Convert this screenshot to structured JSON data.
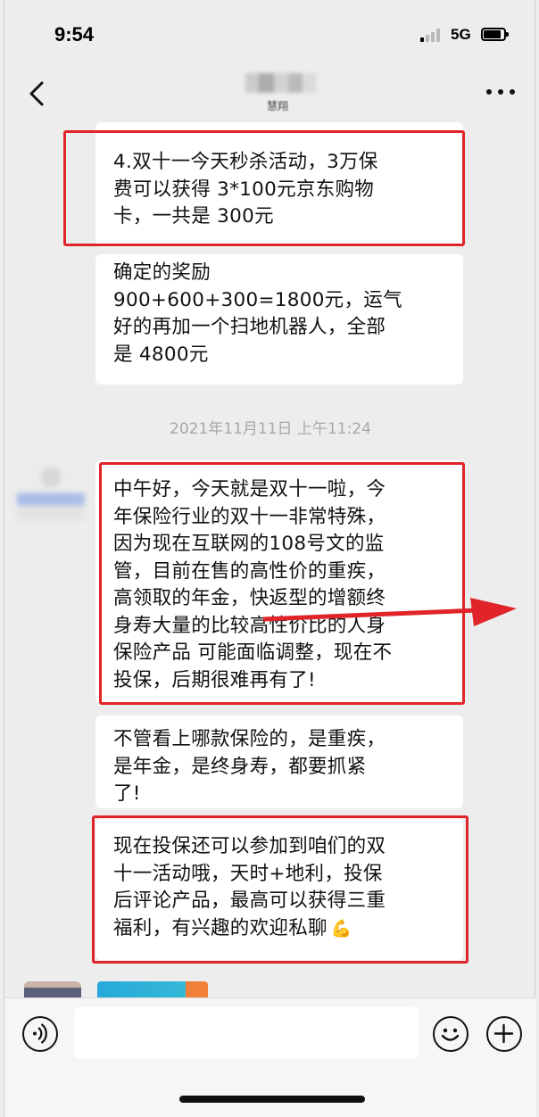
{
  "status_bar": {
    "time": "9:54",
    "network": "5G",
    "signal_bars_active": 1,
    "signal_bars_total": 4,
    "battery_icon": "battery-icon"
  },
  "nav": {
    "back_icon": "chevron-left-icon",
    "contact_name": "慧翔",
    "more_icon": "more-dots-icon"
  },
  "messages": [
    {
      "lines": [
        "4.双十一今天秒杀活动，3万保",
        "费可以获得 3*100元京东购物",
        "卡，一共是 300元"
      ],
      "highlighted": true
    },
    {
      "lines": [
        "确定的奖励",
        "900+600+300=1800元，运气",
        "好的再加一个扫地机器人，全部",
        "是 4800元"
      ],
      "highlighted": false
    }
  ],
  "timestamp": "2021年11月11日 上午11:24",
  "messages2": [
    {
      "lines": [
        "中午好，今天就是双十一啦，今",
        "年保险行业的双十一非常特殊，",
        "因为现在互联网的108号文的监",
        "管，目前在售的高性价的重疾，",
        "高领取的年金，快返型的增额终",
        "身寿大量的比较高性价比的人身",
        "保险产品 可能面临调整，现在不",
        "投保，后期很难再有了!"
      ],
      "highlighted": true
    },
    {
      "lines": [
        "不管看上哪款保险的，是重疾，",
        "是年金，是终身寿，都要抓紧",
        "了!"
      ],
      "highlighted": false
    },
    {
      "lines": [
        "现在投保还可以参加到咱们的双",
        "十一活动哦，天时+地利，投保",
        "后评论产品，最高可以获得三重",
        "福利，有兴趣的欢迎私聊"
      ],
      "highlighted": true,
      "trailing_emoji": "💪"
    }
  ],
  "annotation_color": "#e0242a",
  "input_bar": {
    "placeholder": "",
    "voice_icon": "voice-icon",
    "emoji_icon": "emoji-icon",
    "plus_icon": "plus-icon"
  }
}
